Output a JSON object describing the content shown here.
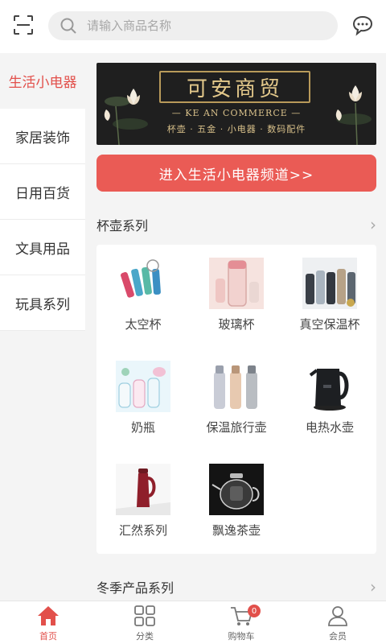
{
  "header": {
    "search_placeholder": "请输入商品名称"
  },
  "sidebar": {
    "items": [
      {
        "label": "生活小电器",
        "active": true
      },
      {
        "label": "家居装饰",
        "active": false
      },
      {
        "label": "日用百货",
        "active": false
      },
      {
        "label": "文具用品",
        "active": false
      },
      {
        "label": "玩具系列",
        "active": false
      }
    ]
  },
  "banner": {
    "brand": "可安商贸",
    "english": "— KE AN COMMERCE —",
    "tags": "杯壶 · 五金 · 小电器 · 数码配件"
  },
  "channel_button": "进入生活小电器频道>>",
  "sections": [
    {
      "title": "杯壶系列",
      "products": [
        {
          "name": "太空杯"
        },
        {
          "name": "玻璃杯"
        },
        {
          "name": "真空保温杯"
        },
        {
          "name": "奶瓶"
        },
        {
          "name": "保温旅行壶"
        },
        {
          "name": "电热水壶"
        },
        {
          "name": "汇然系列"
        },
        {
          "name": "飘逸茶壶"
        }
      ]
    },
    {
      "title": "冬季产品系列"
    }
  ],
  "bottom_nav": {
    "tabs": [
      {
        "label": "首页",
        "icon": "home-icon",
        "active": true
      },
      {
        "label": "分类",
        "icon": "grid-icon",
        "active": false
      },
      {
        "label": "购物车",
        "icon": "cart-icon",
        "active": false,
        "badge": "0"
      },
      {
        "label": "会员",
        "icon": "user-icon",
        "active": false
      }
    ]
  },
  "colors": {
    "accent": "#e2504b",
    "button": "#ea5b55"
  }
}
